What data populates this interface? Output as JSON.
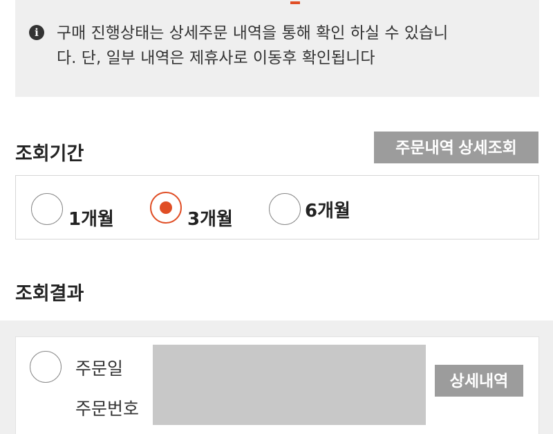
{
  "notice": {
    "icon": "info-icon",
    "line1": "구매 진행상태는 상세주문 내역을 통해 확인 하실 수 있습니",
    "line2": "다. 단, 일부 내역은 제휴사로 이동후 확인됩니다"
  },
  "period": {
    "title": "조회기간",
    "detail_search_label": "주문내역 상세조회",
    "options": [
      {
        "label": "1개월",
        "selected": false
      },
      {
        "label": "3개월",
        "selected": true
      },
      {
        "label": "6개월",
        "selected": false
      }
    ]
  },
  "result": {
    "title": "조회결과",
    "order_date_label": "주문일",
    "order_number_label": "주문번호",
    "detail_button_label": "상세내역"
  },
  "colors": {
    "accent": "#e04e25",
    "button_gray": "#9c9c9c",
    "panel_bg": "#efefef"
  }
}
